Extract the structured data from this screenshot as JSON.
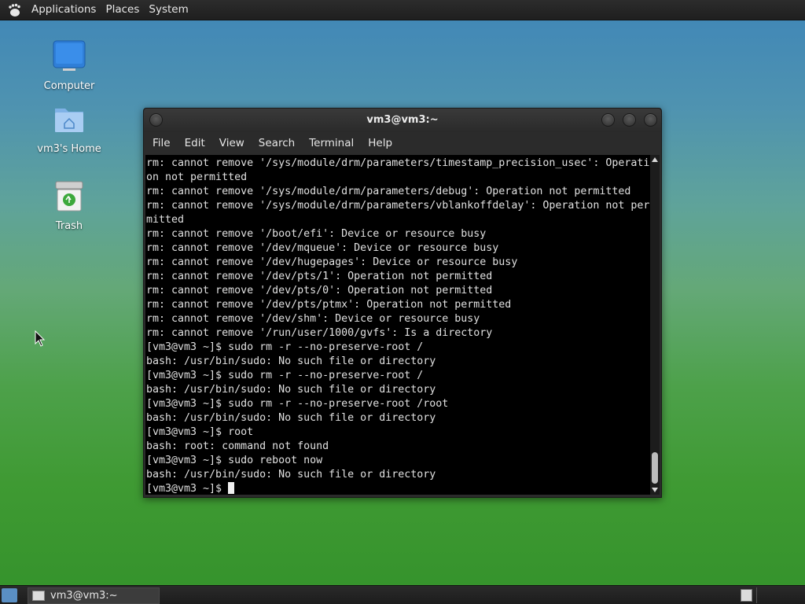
{
  "top_panel": {
    "menus": [
      "Applications",
      "Places",
      "System"
    ]
  },
  "desktop": {
    "icons": [
      {
        "label": "Computer",
        "icon": "computer-icon"
      },
      {
        "label": "vm3's Home",
        "icon": "home-folder-icon"
      },
      {
        "label": "Trash",
        "icon": "trash-icon"
      }
    ]
  },
  "terminal": {
    "title": "vm3@vm3:~",
    "menus": [
      "File",
      "Edit",
      "View",
      "Search",
      "Terminal",
      "Help"
    ],
    "lines": [
      "rm: cannot remove '/sys/module/drm/parameters/timestamp_precision_usec': Operati",
      "on not permitted",
      "rm: cannot remove '/sys/module/drm/parameters/debug': Operation not permitted",
      "rm: cannot remove '/sys/module/drm/parameters/vblankoffdelay': Operation not per",
      "mitted",
      "rm: cannot remove '/boot/efi': Device or resource busy",
      "rm: cannot remove '/dev/mqueue': Device or resource busy",
      "rm: cannot remove '/dev/hugepages': Device or resource busy",
      "rm: cannot remove '/dev/pts/1': Operation not permitted",
      "rm: cannot remove '/dev/pts/0': Operation not permitted",
      "rm: cannot remove '/dev/pts/ptmx': Operation not permitted",
      "rm: cannot remove '/dev/shm': Device or resource busy",
      "rm: cannot remove '/run/user/1000/gvfs': Is a directory",
      "[vm3@vm3 ~]$ sudo rm -r --no-preserve-root /",
      "bash: /usr/bin/sudo: No such file or directory",
      "[vm3@vm3 ~]$ sudo rm -r --no-preserve-root /",
      "bash: /usr/bin/sudo: No such file or directory",
      "[vm3@vm3 ~]$ sudo rm -r --no-preserve-root /root",
      "bash: /usr/bin/sudo: No such file or directory",
      "[vm3@vm3 ~]$ root",
      "bash: root: command not found",
      "[vm3@vm3 ~]$ sudo reboot now",
      "bash: /usr/bin/sudo: No such file or directory"
    ],
    "prompt": "[vm3@vm3 ~]$ "
  },
  "taskbar": {
    "window_label": "vm3@vm3:~"
  },
  "colors": {
    "panel_bg": "#252525",
    "terminal_bg": "#000000",
    "terminal_fg": "#e0e0e0"
  }
}
